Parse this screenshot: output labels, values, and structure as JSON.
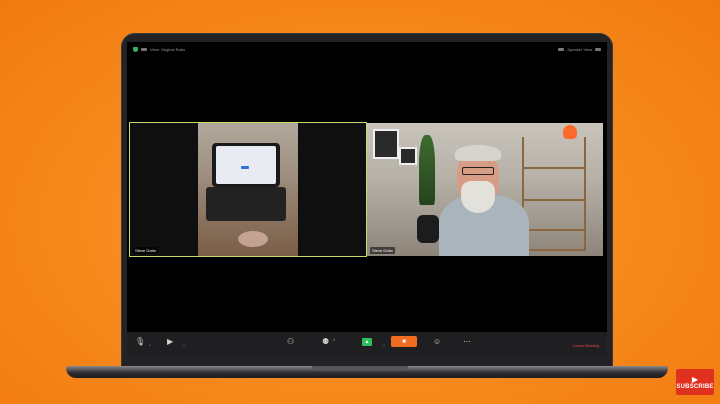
{
  "window": {
    "top_left_text": "View: Original Ratio",
    "top_right_text": "Speaker View"
  },
  "participants": [
    {
      "name": "Steve Dotto",
      "view": "phone-camera"
    },
    {
      "name": "Steve Dotto",
      "view": "webcam"
    }
  ],
  "toolbar": {
    "mute_icon": "mic-icon",
    "video_icon": "video-camera-icon",
    "security_icon": "people-add-icon",
    "participants_icon": "participants-icon",
    "participants_count": "2",
    "share_icon": "share-screen-icon",
    "record_icon": "record-icon",
    "reactions_icon": "smile-icon",
    "more_icon": "more-icon",
    "leave_label": "Leave Meeting",
    "share_glyph": "▲"
  },
  "overlay": {
    "subscribe_label": "SUBSCRIBE",
    "subscribe_play": "▶"
  },
  "colors": {
    "background": "#f7891c",
    "share_button": "#f26d21",
    "active_speaker_border": "#c9d96a",
    "leave_red": "#e64848",
    "subscribe_red": "#e0301e"
  }
}
